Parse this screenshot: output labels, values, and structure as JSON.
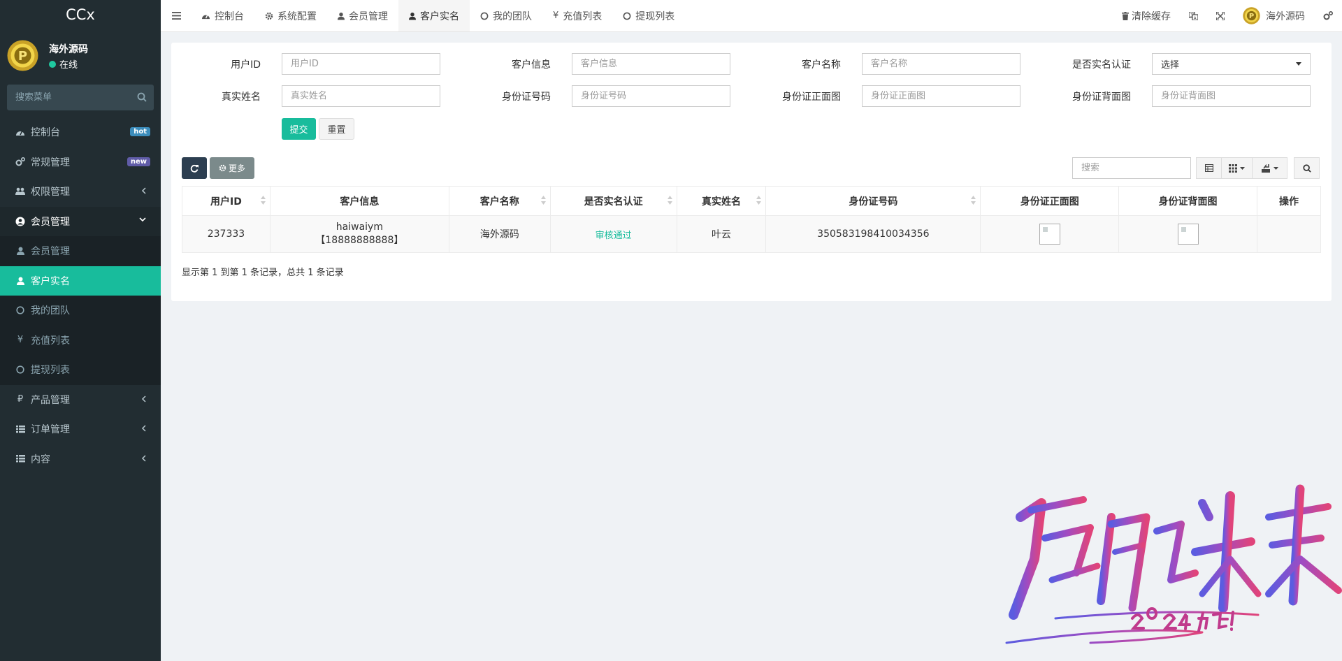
{
  "sidebar": {
    "brand": "CCx",
    "user": {
      "name": "海外源码",
      "status": "在线"
    },
    "search_placeholder": "搜索菜单",
    "menu": [
      {
        "label": "控制台",
        "icon": "dashboard-icon",
        "badge": "hot",
        "badge_color": "#3c8dbc"
      },
      {
        "label": "常规管理",
        "icon": "cogs-icon",
        "badge": "new",
        "badge_color": "#605ca8"
      },
      {
        "label": "权限管理",
        "icon": "group-icon"
      },
      {
        "label": "会员管理",
        "icon": "user-circle-icon",
        "open": true
      },
      {
        "label": "产品管理",
        "icon": "ruble-icon"
      },
      {
        "label": "订单管理",
        "icon": "list-icon"
      },
      {
        "label": "内容",
        "icon": "list-icon"
      }
    ],
    "submenu": [
      {
        "label": "会员管理",
        "icon": "user-icon"
      },
      {
        "label": "客户实名",
        "icon": "user-icon",
        "active": true
      },
      {
        "label": "我的团队",
        "icon": "circle-icon"
      },
      {
        "label": "充值列表",
        "icon": "yen-icon"
      },
      {
        "label": "提现列表",
        "icon": "circle-icon"
      }
    ]
  },
  "topbar": {
    "tabs": [
      {
        "label": "控制台",
        "icon": "dashboard-icon"
      },
      {
        "label": "系统配置",
        "icon": "gear-icon"
      },
      {
        "label": "会员管理",
        "icon": "user-icon"
      },
      {
        "label": "客户实名",
        "icon": "user-icon",
        "active": true
      },
      {
        "label": "我的团队",
        "icon": "circle-icon"
      },
      {
        "label": "充值列表",
        "icon": "yen-icon"
      },
      {
        "label": "提现列表",
        "icon": "circle-icon"
      }
    ],
    "right": {
      "clear_cache": "清除缓存",
      "username": "海外源码"
    }
  },
  "filter": {
    "fields": [
      {
        "label": "用户ID",
        "placeholder": "用户ID"
      },
      {
        "label": "客户信息",
        "placeholder": "客户信息"
      },
      {
        "label": "客户名称",
        "placeholder": "客户名称"
      },
      {
        "label": "是否实名认证",
        "select": "选择"
      },
      {
        "label": "真实姓名",
        "placeholder": "真实姓名"
      },
      {
        "label": "身份证号码",
        "placeholder": "身份证号码"
      },
      {
        "label": "身份证正面图",
        "placeholder": "身份证正面图"
      },
      {
        "label": "身份证背面图",
        "placeholder": "身份证背面图"
      }
    ],
    "submit": "提交",
    "reset": "重置"
  },
  "toolbar": {
    "more": "更多",
    "search_placeholder": "搜索"
  },
  "table": {
    "headers": [
      "用户ID",
      "客户信息",
      "客户名称",
      "是否实名认证",
      "真实姓名",
      "身份证号码",
      "身份证正面图",
      "身份证背面图",
      "操作"
    ],
    "rows": [
      {
        "id": "237333",
        "info_line1": "haiwaiym",
        "info_line2": "【18888888888】",
        "name": "海外源码",
        "verified": "审核通过",
        "real_name": "叶云",
        "id_number": "350583198410034356"
      }
    ]
  },
  "pagination": "显示第 1 到第 1 条记录，总共 1 条记录",
  "colors": {
    "accent": "#18bc9c",
    "sidebar": "#222d32",
    "navy": "#2c3e50"
  }
}
